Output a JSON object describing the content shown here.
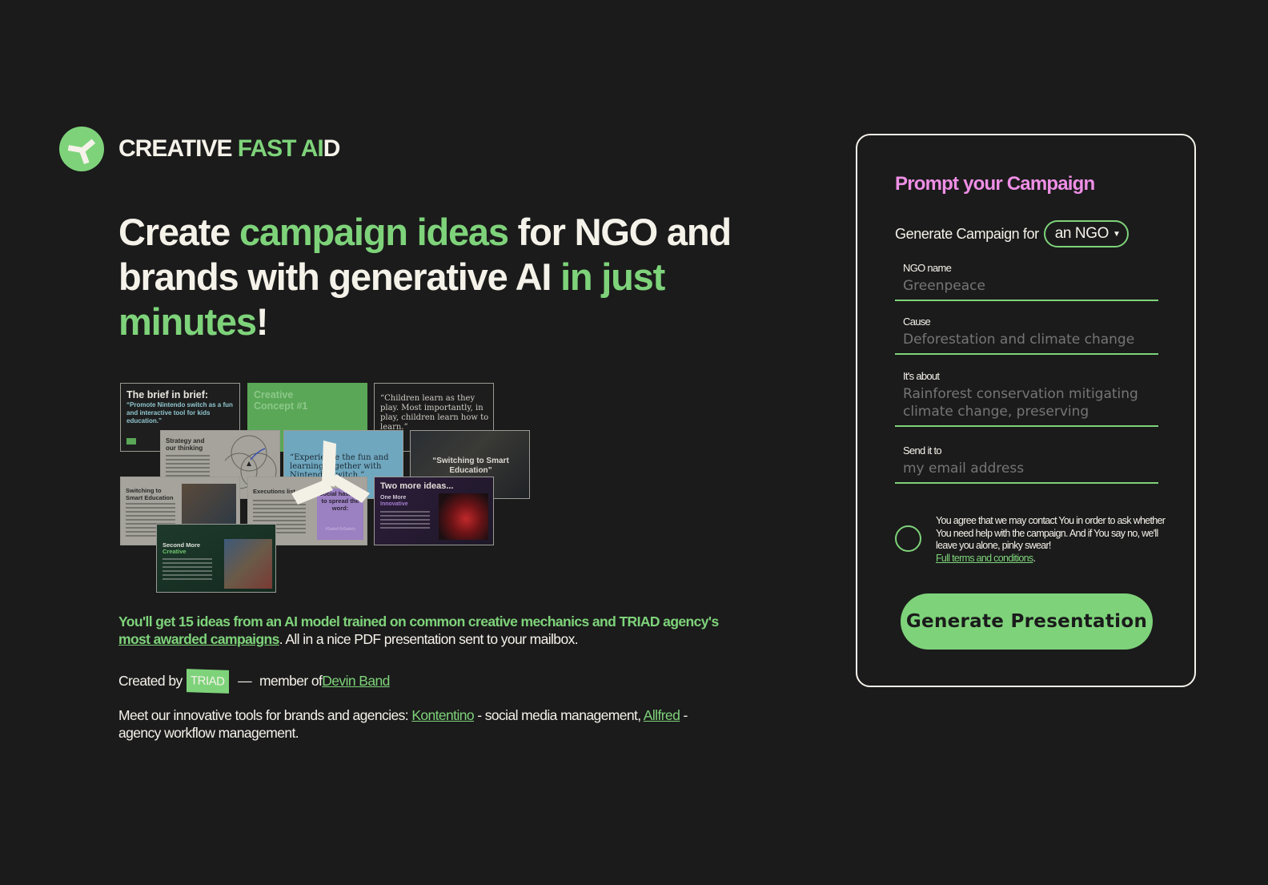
{
  "brand": {
    "part1": "CREATIVE ",
    "part2": "FAST AI",
    "part3": "D",
    "logo_icon": "tri-blade-logo-icon",
    "accent_color": "#7ed37a",
    "title_color": "#ef8fe6"
  },
  "headline": {
    "p1": "Create ",
    "p2": "campaign ideas",
    "p3": " for NGO and brands with generative AI ",
    "p4": "in just minutes",
    "p5": "!"
  },
  "collage": {
    "slides": [
      {
        "title": "The brief in brief:",
        "body": "“Promote Nintendo switch as a fun and interactive tool for kids education.”"
      },
      {
        "title": "Creative Concept #1"
      },
      {
        "title": "“Children learn as they play. Most importantly, in play, children learn how to learn.”"
      },
      {
        "title": "Strategy and our thinking"
      },
      {
        "title": "“Experience the fun and learning together with Nintendo Switch.”"
      },
      {
        "title": "“Switching to Smart Education”"
      },
      {
        "title": "Switching to Smart Education"
      },
      {
        "title": "Executions list",
        "side": "Social hashtag to spread the word:",
        "tag": "#SwitchToSwitch"
      },
      {
        "title": "Two more ideas...",
        "sub1": "One More",
        "sub2": "Innovative"
      },
      {
        "title": "Second More",
        "sub": "Creative"
      }
    ]
  },
  "intro": {
    "highlight": "You'll get 15 ideas from an AI model trained on common creative mechanics and TRIAD agency's ",
    "link": "most awarded campaigns",
    "rest": ". All in a nice PDF presentation sent to your mailbox."
  },
  "created": {
    "label": "Created by",
    "badge": "TRIAD",
    "dash": "—",
    "member": "member of ",
    "member_link": "Devin Band"
  },
  "tools": {
    "intro": "Meet our innovative tools for brands and agencies: ",
    "tool1": "Kontentino",
    "tool1_desc": " - social media management, ",
    "tool2": "Allfred",
    "tool2_desc": " - agency workflow management."
  },
  "form": {
    "title": "Prompt your Campaign",
    "generate_for_label": "Generate Campaign for",
    "generate_for_value": "an NGO",
    "fields": [
      {
        "label": "NGO name",
        "placeholder": "Greenpeace"
      },
      {
        "label": "Cause",
        "placeholder": "Deforestation and climate change"
      },
      {
        "label": "It's about",
        "placeholder": "Rainforest conservation mitigating climate change, preserving"
      },
      {
        "label": "Send it to",
        "placeholder": "my email address"
      }
    ],
    "consent_text": "You agree that we may contact You in order to ask whether You need help with the campaign. And if You say no, we'll leave you alone, pinky swear!",
    "consent_link": "Full terms and conditions",
    "consent_end": ".",
    "submit_label": "Generate Presentation"
  }
}
